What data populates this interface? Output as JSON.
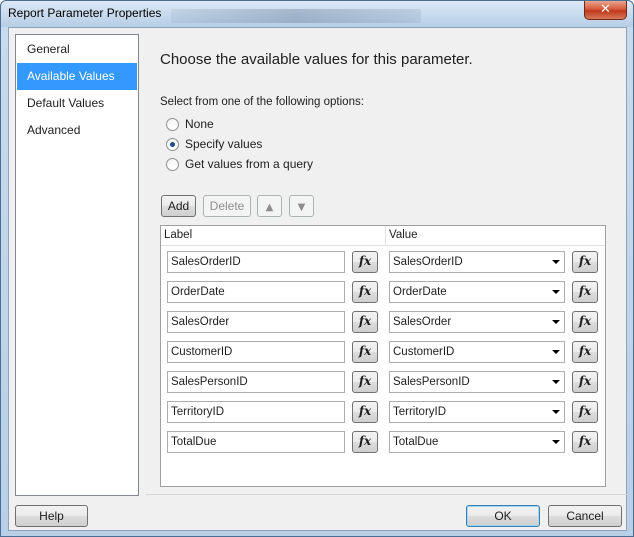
{
  "window": {
    "title": "Report Parameter Properties",
    "close_glyph": "✕"
  },
  "nav": {
    "items": [
      {
        "label": "General",
        "selected": false
      },
      {
        "label": "Available Values",
        "selected": true
      },
      {
        "label": "Default Values",
        "selected": false
      },
      {
        "label": "Advanced",
        "selected": false
      }
    ]
  },
  "main": {
    "heading": "Choose the available values for this parameter.",
    "options_label": "Select from one of the following options:",
    "options": [
      {
        "label": "None",
        "checked": false
      },
      {
        "label": "Specify values",
        "checked": true
      },
      {
        "label": "Get values from a query",
        "checked": false
      }
    ],
    "toolbar": {
      "add_label": "Add",
      "delete_label": "Delete",
      "move_up_icon": "arrow-up-icon",
      "move_down_icon": "arrow-down-icon"
    },
    "grid": {
      "label_header": "Label",
      "value_header": "Value",
      "expression_button": "fx",
      "rows": [
        {
          "label": "SalesOrderID",
          "value": "SalesOrderID"
        },
        {
          "label": "OrderDate",
          "value": "OrderDate"
        },
        {
          "label": "SalesOrder",
          "value": "SalesOrder"
        },
        {
          "label": "CustomerID",
          "value": "CustomerID"
        },
        {
          "label": "SalesPersonID",
          "value": "SalesPersonID"
        },
        {
          "label": "TerritoryID",
          "value": "TerritoryID"
        },
        {
          "label": "TotalDue",
          "value": "TotalDue"
        }
      ]
    }
  },
  "footer": {
    "help_label": "Help",
    "ok_label": "OK",
    "cancel_label": "Cancel"
  },
  "colors": {
    "selection": "#3399ff",
    "dialog_bg": "#f0f0f0"
  }
}
